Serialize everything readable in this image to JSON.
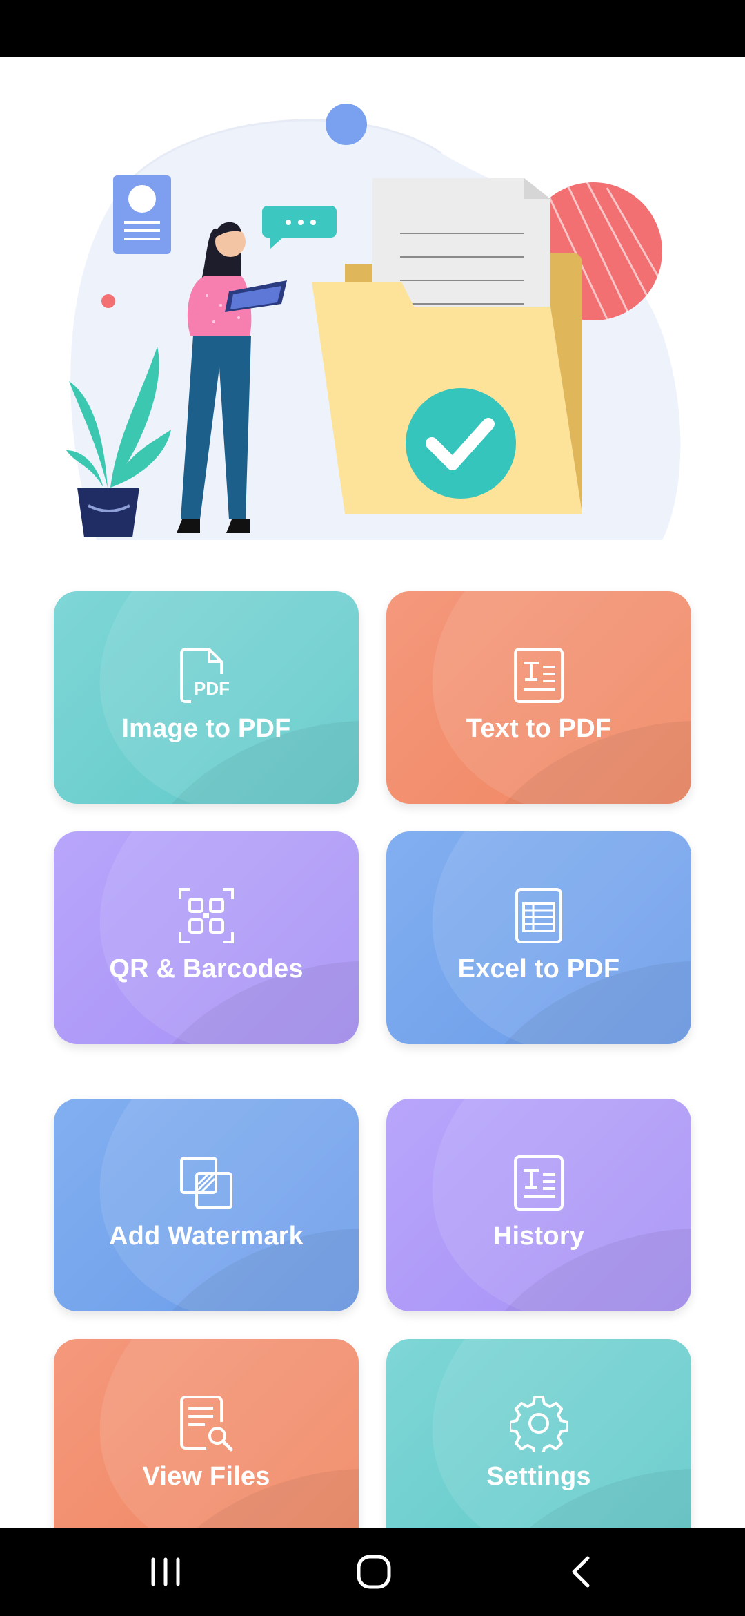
{
  "cards": [
    {
      "label": "Image to PDF",
      "icon": "pdf-file-icon",
      "color": "#6dd0d0"
    },
    {
      "label": "Text to PDF",
      "icon": "text-document-icon",
      "color": "#f28c6b"
    },
    {
      "label": "QR & Barcodes",
      "icon": "qr-code-icon",
      "color": "#ad98f8"
    },
    {
      "label": "Excel to PDF",
      "icon": "spreadsheet-icon",
      "color": "#74a4ec"
    },
    {
      "label": "Add Watermark",
      "icon": "watermark-icon",
      "color": "#74a4ec"
    },
    {
      "label": "History",
      "icon": "text-document-icon",
      "color": "#ad98f8"
    },
    {
      "label": "View Files",
      "icon": "file-search-icon",
      "color": "#f28c6b"
    },
    {
      "label": "Settings",
      "icon": "gear-icon",
      "color": "#6dd0d0"
    }
  ],
  "hero": {
    "illustration": "woman-with-tablet-and-folder-illustration"
  },
  "nav": [
    "recent-apps-icon",
    "home-icon",
    "back-icon"
  ]
}
